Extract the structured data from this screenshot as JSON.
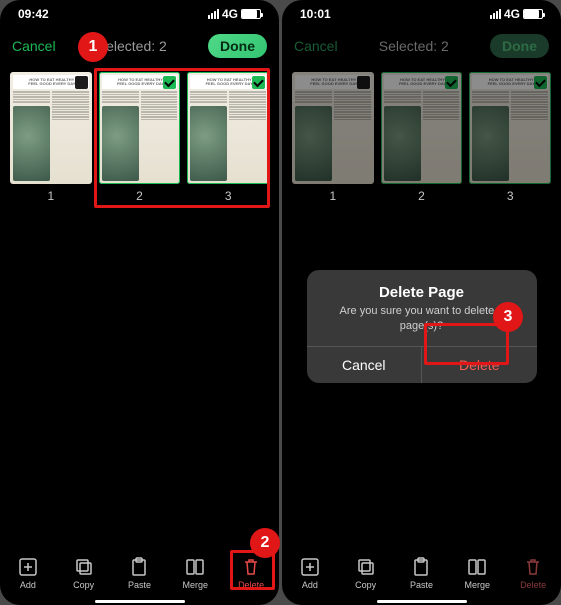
{
  "left": {
    "time": "09:42",
    "network": "4G",
    "cancel": "Cancel",
    "title": "Selected: 2",
    "done": "Done",
    "thumbs": [
      {
        "num": "1",
        "selected": false,
        "headline_small": "HOW TO EAT HEALTHY",
        "headline": "FEEL GOOD EVERY DAY"
      },
      {
        "num": "2",
        "selected": true,
        "headline_small": "HOW TO EAT HEALTHY",
        "headline": "FEEL GOOD EVERY DAY"
      },
      {
        "num": "3",
        "selected": true,
        "headline_small": "HOW TO EAT HEALTHY",
        "headline": "FEEL GOOD EVERY DAY"
      }
    ],
    "toolbar": {
      "add": "Add",
      "copy": "Copy",
      "paste": "Paste",
      "merge": "Merge",
      "delete": "Delete"
    }
  },
  "right": {
    "time": "10:01",
    "network": "4G",
    "cancel": "Cancel",
    "title": "Selected: 2",
    "done": "Done",
    "thumbs": [
      {
        "num": "1",
        "selected": false,
        "headline_small": "HOW TO EAT HEALTHY",
        "headline": "FEEL GOOD EVERY DAY"
      },
      {
        "num": "2",
        "selected": true,
        "headline_small": "HOW TO EAT HEALTHY",
        "headline": "FEEL GOOD EVERY DAY"
      },
      {
        "num": "3",
        "selected": true,
        "headline_small": "HOW TO EAT HEALTHY",
        "headline": "FEEL GOOD EVERY DAY"
      }
    ],
    "toolbar": {
      "add": "Add",
      "copy": "Copy",
      "paste": "Paste",
      "merge": "Merge",
      "delete": "Delete"
    },
    "dialog": {
      "title": "Delete Page",
      "message": "Are you sure you want to delete 2 page(s)?",
      "cancel": "Cancel",
      "delete": "Delete"
    }
  },
  "annotations": {
    "b1": "1",
    "b2": "2",
    "b3": "3"
  }
}
